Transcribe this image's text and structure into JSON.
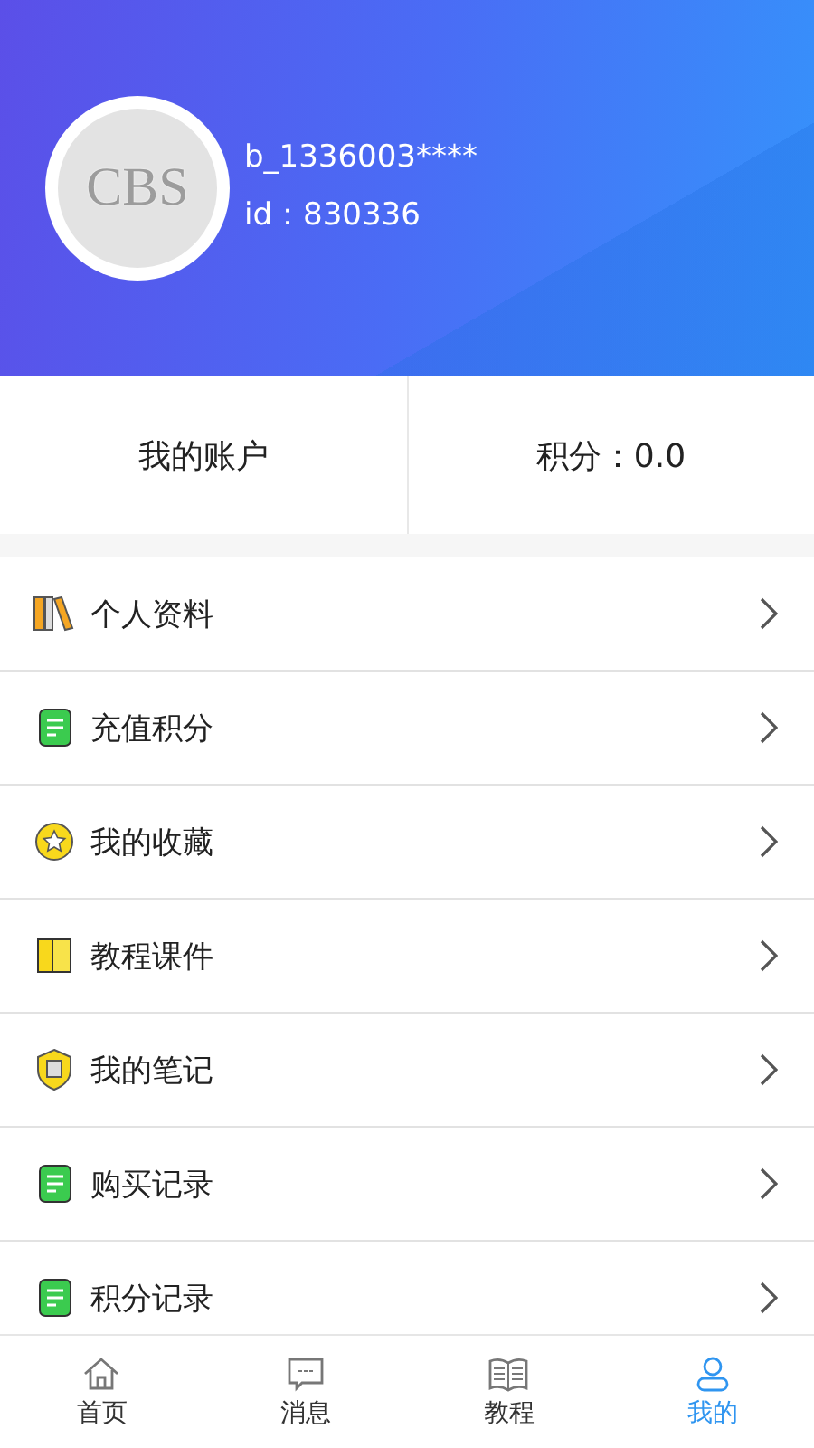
{
  "profile": {
    "avatar_text": "CBS",
    "username": "b_1336003****",
    "id": "id：830336"
  },
  "stats": [
    {
      "label": "我的账户"
    },
    {
      "label": "积分：0.0"
    }
  ],
  "menu": [
    {
      "label": "个人资料",
      "kind": "books"
    },
    {
      "label": "充值积分",
      "kind": "note"
    },
    {
      "label": "我的收藏",
      "kind": "star"
    },
    {
      "label": "教程课件",
      "kind": "book"
    },
    {
      "label": "我的笔记",
      "kind": "shield"
    },
    {
      "label": "购买记录",
      "kind": "note"
    },
    {
      "label": "积分记录",
      "kind": "note"
    }
  ],
  "tabs": [
    {
      "label": "首页",
      "kind": "home",
      "selected": false
    },
    {
      "label": "消息",
      "kind": "message",
      "selected": false
    },
    {
      "label": "教程",
      "kind": "book",
      "selected": false
    },
    {
      "label": "我的",
      "kind": "user",
      "selected": true
    }
  ]
}
